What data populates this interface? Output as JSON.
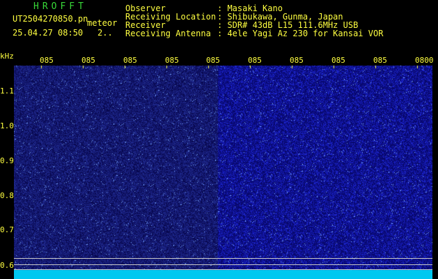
{
  "app": {
    "title": "HROFFT"
  },
  "file": {
    "name": "UT2504270850.pn",
    "tag": "meteor",
    "datetime": "25.04.27 08:50",
    "index": "2.."
  },
  "info": {
    "labels": [
      "Observer",
      "Receiving Location",
      "Receiver",
      "Receiving Antenna"
    ],
    "values": [
      ": Masaki Kano",
      ": Shibukawa, Gunma, Japan",
      ": SDR# 43dB L15 111.6MHz USB",
      ": 4ele Yagi Az 230 for Kansai VOR"
    ]
  },
  "axis": {
    "y_unit": "kHz",
    "y_ticks": [
      "1.1",
      "1.0",
      "0.9",
      "0.8",
      "0.7",
      "0.6"
    ],
    "x_ticks": [
      "085",
      "085",
      "085",
      "085",
      "085",
      "085",
      "085",
      "085",
      "085",
      "0800"
    ]
  },
  "colors": {
    "noise_dark": "#10106a",
    "noise_bright": "#2a3ad0",
    "signal": "#00e0ff",
    "text_yellow": "#ffff40",
    "title_green": "#38d838"
  }
}
